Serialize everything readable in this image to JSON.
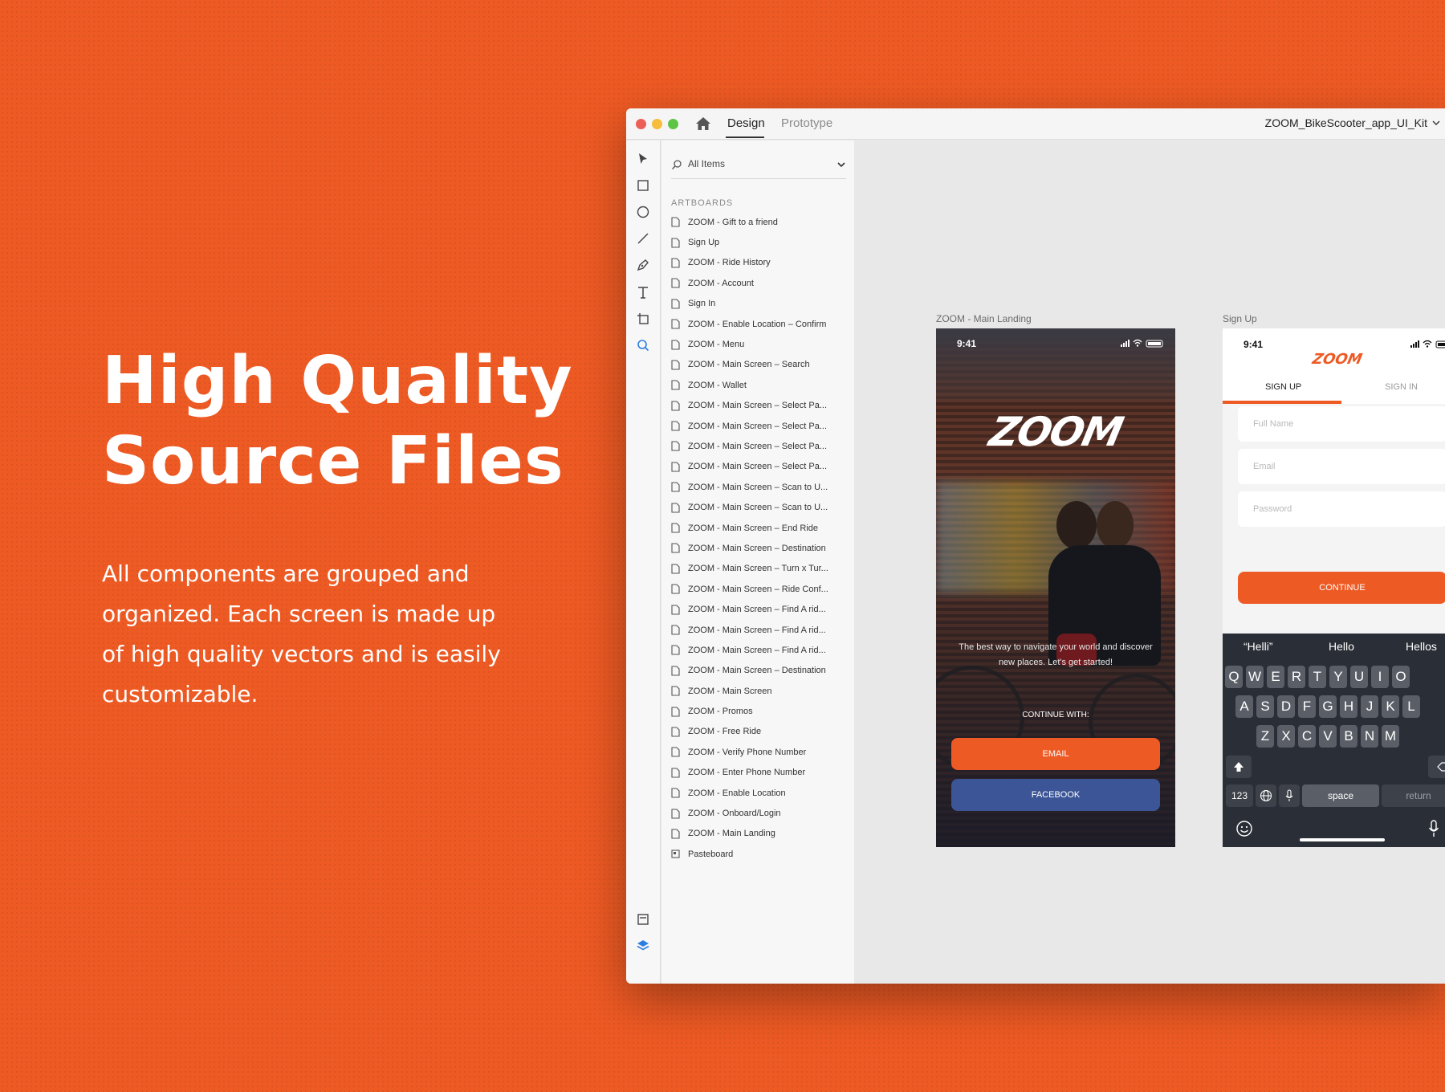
{
  "promo": {
    "headline": "High Quality Source Files",
    "body": "All components are grouped and organized. Each screen is made up of high quality vectors and is easily customizable."
  },
  "window": {
    "tabs": {
      "design": "Design",
      "prototype": "Prototype"
    },
    "document_title": "ZOOM_BikeScooter_app_UI_Kit",
    "icons": [
      "home-icon",
      "chevron-down-icon"
    ]
  },
  "toolbar": {
    "tools": [
      "select-tool-icon",
      "rectangle-tool-icon",
      "ellipse-tool-icon",
      "line-tool-icon",
      "pen-tool-icon",
      "text-tool-icon",
      "artboard-tool-icon",
      "zoom-tool-icon"
    ],
    "bottom": [
      "assets-icon",
      "layers-icon"
    ]
  },
  "panel": {
    "search_label": "All Items",
    "section_label": "ARTBOARDS",
    "artboards": [
      "ZOOM - Gift to a friend",
      "Sign Up",
      "ZOOM - Ride History",
      "ZOOM - Account",
      "Sign In",
      "ZOOM - Enable Location – Confirm",
      "ZOOM - Menu",
      "ZOOM - Main Screen – Search",
      "ZOOM - Wallet",
      "ZOOM - Main Screen – Select Pa...",
      "ZOOM - Main Screen – Select Pa...",
      "ZOOM - Main Screen – Select Pa...",
      "ZOOM - Main Screen – Select Pa...",
      "ZOOM - Main Screen – Scan to U...",
      "ZOOM - Main Screen – Scan to U...",
      "ZOOM - Main Screen – End Ride",
      "ZOOM - Main Screen – Destination",
      "ZOOM - Main Screen – Turn x Tur...",
      "ZOOM - Main Screen – Ride Conf...",
      "ZOOM - Main Screen – Find A rid...",
      "ZOOM - Main Screen – Find A rid...",
      "ZOOM - Main Screen – Find A rid...",
      "ZOOM - Main Screen – Destination",
      "ZOOM - Main Screen",
      "ZOOM - Promos",
      "ZOOM - Free Ride",
      "ZOOM - Verify Phone Number",
      "ZOOM - Enter Phone Number",
      "ZOOM - Enable Location",
      "ZOOM - Onboard/Login",
      "ZOOM - Main Landing"
    ],
    "pasteboard": "Pasteboard"
  },
  "canvas": {
    "landing": {
      "label": "ZOOM - Main Landing",
      "time": "9:41",
      "logo": "ZOOM",
      "tagline": "The best way to navigate your world and discover new places. Let's get started!",
      "continue_with": "CONTINUE WITH:",
      "email_button": "EMAIL",
      "facebook_button": "FACEBOOK"
    },
    "signup": {
      "label": "Sign Up",
      "time": "9:41",
      "logo": "ZOOM",
      "tab_signup": "SIGN UP",
      "tab_signin": "SIGN IN",
      "full_name_placeholder": "Full Name",
      "email_placeholder": "Email",
      "password_placeholder": "Password",
      "continue_button": "CONTINUE",
      "suggestions": [
        "“Helli”",
        "Hello",
        "Hellos"
      ],
      "row1": [
        "Q",
        "W",
        "E",
        "R",
        "T",
        "Y",
        "U",
        "I",
        "O"
      ],
      "row2": [
        "A",
        "S",
        "D",
        "F",
        "G",
        "H",
        "J",
        "K",
        "L"
      ],
      "row3": [
        "Z",
        "X",
        "C",
        "V",
        "B",
        "N",
        "M"
      ],
      "key_123": "123",
      "key_space": "space",
      "key_return": "return"
    }
  },
  "colors": {
    "brand_orange": "#ee5a24",
    "facebook_blue": "#3b5597",
    "keyboard_bg": "#2a2e36"
  }
}
